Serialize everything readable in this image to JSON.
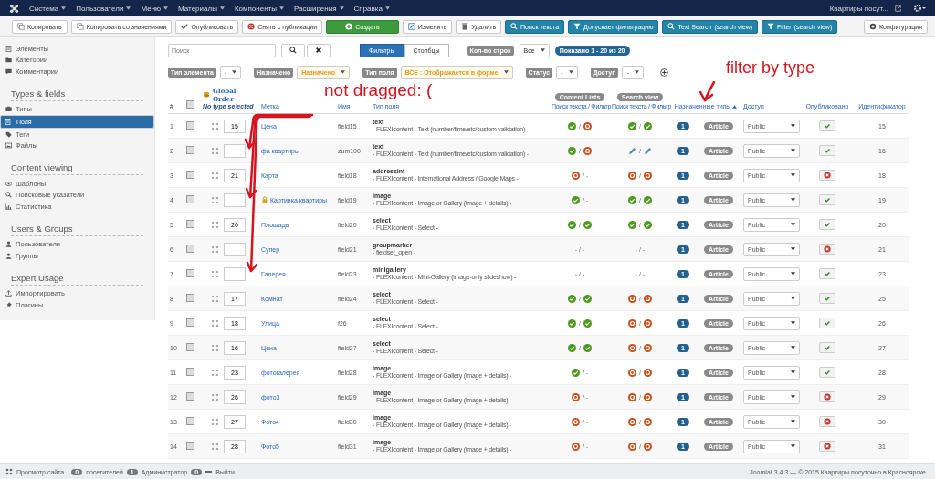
{
  "topnav": {
    "menus": [
      "Система",
      "Пользователи",
      "Меню",
      "Материалы",
      "Компоненты",
      "Расширения",
      "Справка"
    ],
    "site_link": "Квартиры посут..."
  },
  "toolbar": {
    "buttons": [
      {
        "label": "Копировать",
        "kind": "copy"
      },
      {
        "label": "Копировать со значениями",
        "kind": "copy"
      },
      {
        "label": "Опубликовать",
        "kind": "publish"
      },
      {
        "label": "Снять с публикации",
        "kind": "unpublish"
      },
      {
        "label": "Создать",
        "kind": "create"
      },
      {
        "label": "Изменить",
        "kind": "edit"
      },
      {
        "label": "Удалить",
        "kind": "delete"
      },
      {
        "label": "Поиск текста",
        "kind": "search"
      },
      {
        "label": "Допускает фильтрацию",
        "kind": "filter"
      },
      {
        "label": "Text Search",
        "sub": "(search view)",
        "kind": "search"
      },
      {
        "label": "Filter",
        "sub": "(search view)",
        "kind": "filter"
      }
    ],
    "config": "Конфигурация"
  },
  "sidebar": {
    "sections": [
      {
        "items": [
          {
            "label": "Элементы",
            "kind": "doc",
            "selected": false
          },
          {
            "label": "Категории",
            "kind": "folder",
            "selected": false
          },
          {
            "label": "Комментарии",
            "kind": "chat",
            "selected": false
          }
        ]
      },
      {
        "title": "Types & fields",
        "items": [
          {
            "label": "Типы",
            "kind": "box",
            "selected": false
          },
          {
            "label": "Поля",
            "kind": "doc",
            "selected": true
          },
          {
            "label": "Теги",
            "kind": "tag",
            "selected": false
          },
          {
            "label": "Файлы",
            "kind": "image",
            "selected": false
          }
        ]
      },
      {
        "title": "Content viewing",
        "items": [
          {
            "label": "Шаблоны",
            "kind": "eye",
            "selected": false
          },
          {
            "label": "Поисковые указатели",
            "kind": "search",
            "selected": false
          },
          {
            "label": "Статистика",
            "kind": "chart",
            "selected": false
          }
        ]
      },
      {
        "title": "Users & Groups",
        "items": [
          {
            "label": "Пользователи",
            "kind": "user",
            "selected": false
          },
          {
            "label": "Группы",
            "kind": "user",
            "selected": false
          }
        ]
      },
      {
        "title": "Expert Usage",
        "items": [
          {
            "label": "Импортировать",
            "kind": "upload",
            "selected": false
          },
          {
            "label": "Плагины",
            "kind": "plug",
            "selected": false
          }
        ]
      }
    ]
  },
  "search": {
    "placeholder": "Поиск"
  },
  "view_toggle": [
    {
      "label": "Фильтры",
      "selected": true
    },
    {
      "label": "Столбцы",
      "selected": false
    }
  ],
  "rows_per_page": {
    "label": "Кол-во строк",
    "value": "Все"
  },
  "shown_badge": "Показано 1 - 20 из 20",
  "filters": [
    {
      "label": "Тип элемента",
      "value": "-",
      "active": false
    },
    {
      "label": "Назначено",
      "value": "Назначено",
      "active": true
    },
    {
      "label": "Тип поля",
      "value": "ВСЕ : Отображается в форме",
      "active": true
    },
    {
      "label": "Статус",
      "value": "-",
      "active": false
    },
    {
      "label": "Доступ",
      "value": "-",
      "active": false
    }
  ],
  "table": {
    "columns": {
      "number": "#",
      "global_order": "Global Order",
      "global_order_note": "No type selected",
      "label": "Метка",
      "name": "Имя",
      "field_type": "Тип поля",
      "content_lists": "Content Lists",
      "content_lists_sub": "Поиск текста / Фильтр",
      "search_view": "Search view",
      "search_view_sub": "Поиск текста / Фильтр",
      "assigned_types": "Назначенные типы",
      "access": "Доступ",
      "published": "Опубликовано",
      "id": "Идентификатор"
    },
    "header_checked": false,
    "rows": [
      {
        "number": "1",
        "checked": false,
        "order": "15",
        "label": "Цена",
        "locked": false,
        "name": "field15",
        "type": "text",
        "description": "- FLEXIcontent - Text (number/time/etc/custom validation) -",
        "content_lists": [
          {
            "kind": "yes"
          },
          {
            "kind": "text",
            "text": "/"
          },
          {
            "kind": "no"
          }
        ],
        "search_view": [
          {
            "kind": "yes"
          },
          {
            "kind": "text",
            "text": "/"
          },
          {
            "kind": "yes"
          }
        ],
        "types_count": "1",
        "type_tag": "Article",
        "access": "Public",
        "published": true,
        "id": "15"
      },
      {
        "number": "2",
        "checked": false,
        "order": "",
        "label": "фа квартиры",
        "locked": false,
        "name": "zum100",
        "type": "text",
        "description": "- FLEXIcontent - Text (number/time/etc/custom validation) -",
        "content_lists": [
          {
            "kind": "yes"
          },
          {
            "kind": "text",
            "text": "/"
          },
          {
            "kind": "no"
          }
        ],
        "search_view": [
          {
            "kind": "edit"
          },
          {
            "kind": "text",
            "text": "/"
          },
          {
            "kind": "edit"
          }
        ],
        "types_count": "1",
        "type_tag": "Article",
        "access": "Public",
        "published": true,
        "id": "16"
      },
      {
        "number": "3",
        "checked": false,
        "order": "21",
        "label": "Карта",
        "locked": false,
        "name": "field18",
        "type": "addressint",
        "description": "- FLEXIcontent - International Address / Google Maps -",
        "content_lists": [
          {
            "kind": "no"
          },
          {
            "kind": "text",
            "text": "/ -"
          }
        ],
        "search_view": [
          {
            "kind": "no"
          },
          {
            "kind": "text",
            "text": "/"
          },
          {
            "kind": "no"
          }
        ],
        "types_count": "1",
        "type_tag": "Article",
        "access": "Public",
        "published": false,
        "id": "18"
      },
      {
        "number": "4",
        "checked": false,
        "order": "",
        "label": "Картинка квартиры",
        "locked": true,
        "name": "field19",
        "type": "image",
        "description": "- FLEXIcontent - Image or Gallery (image + details) -",
        "content_lists": [
          {
            "kind": "yes"
          },
          {
            "kind": "text",
            "text": "/ -"
          }
        ],
        "search_view": [
          {
            "kind": "yes"
          },
          {
            "kind": "text",
            "text": "/"
          },
          {
            "kind": "yes"
          }
        ],
        "types_count": "1",
        "type_tag": "Article",
        "access": "Public",
        "published": true,
        "id": "19"
      },
      {
        "number": "5",
        "checked": false,
        "order": "20",
        "label": "Площадь",
        "locked": false,
        "name": "field20",
        "type": "select",
        "description": "- FLEXIcontent - Select -",
        "content_lists": [
          {
            "kind": "yes"
          },
          {
            "kind": "text",
            "text": "/"
          },
          {
            "kind": "yes"
          }
        ],
        "search_view": [
          {
            "kind": "yes"
          },
          {
            "kind": "text",
            "text": "/"
          },
          {
            "kind": "yes"
          }
        ],
        "types_count": "1",
        "type_tag": "Article",
        "access": "Public",
        "published": true,
        "id": "20"
      },
      {
        "number": "6",
        "checked": false,
        "order": "",
        "label": "Супер",
        "locked": false,
        "name": "field21",
        "type": "groupmarker",
        "description": "- fieldset_open -",
        "content_lists": [
          {
            "kind": "text",
            "text": "- / -"
          }
        ],
        "search_view": [
          {
            "kind": "text",
            "text": "- / -"
          }
        ],
        "types_count": "1",
        "type_tag": "Article",
        "access": "Public",
        "published": false,
        "id": "21"
      },
      {
        "number": "7",
        "checked": false,
        "order": "",
        "label": "Галерея",
        "locked": false,
        "name": "field23",
        "type": "minigallery",
        "description": "- FLEXIcontent - Mini-Gallery (image-only slideshow) -",
        "content_lists": [
          {
            "kind": "text",
            "text": "- / -"
          }
        ],
        "search_view": [
          {
            "kind": "text",
            "text": "- / -"
          }
        ],
        "types_count": "1",
        "type_tag": "Article",
        "access": "Public",
        "published": true,
        "id": "23"
      },
      {
        "number": "8",
        "checked": false,
        "order": "17",
        "label": "Комнат",
        "locked": false,
        "name": "field24",
        "type": "select",
        "description": "- FLEXIcontent - Select -",
        "content_lists": [
          {
            "kind": "yes"
          },
          {
            "kind": "text",
            "text": "/"
          },
          {
            "kind": "yes"
          }
        ],
        "search_view": [
          {
            "kind": "no"
          },
          {
            "kind": "text",
            "text": "/"
          },
          {
            "kind": "no"
          }
        ],
        "types_count": "1",
        "type_tag": "Article",
        "access": "Public",
        "published": true,
        "id": "25"
      },
      {
        "number": "9",
        "checked": false,
        "order": "18",
        "label": "Улица",
        "locked": false,
        "name": "f26",
        "type": "select",
        "description": "- FLEXIcontent - Select -",
        "content_lists": [
          {
            "kind": "yes"
          },
          {
            "kind": "text",
            "text": "/"
          },
          {
            "kind": "yes"
          }
        ],
        "search_view": [
          {
            "kind": "no"
          },
          {
            "kind": "text",
            "text": "/"
          },
          {
            "kind": "no"
          }
        ],
        "types_count": "1",
        "type_tag": "Article",
        "access": "Public",
        "published": true,
        "id": "26"
      },
      {
        "number": "10",
        "checked": false,
        "order": "16",
        "label": "Цена",
        "locked": false,
        "name": "field27",
        "type": "select",
        "description": "- FLEXIcontent - Select -",
        "content_lists": [
          {
            "kind": "yes"
          },
          {
            "kind": "text",
            "text": "/"
          },
          {
            "kind": "yes"
          }
        ],
        "search_view": [
          {
            "kind": "no"
          },
          {
            "kind": "text",
            "text": "/"
          },
          {
            "kind": "no"
          }
        ],
        "types_count": "1",
        "type_tag": "Article",
        "access": "Public",
        "published": true,
        "id": "27"
      },
      {
        "number": "11",
        "checked": false,
        "order": "23",
        "label": "фотогалерея",
        "locked": false,
        "name": "field28",
        "type": "image",
        "description": "- FLEXIcontent - Image or Gallery (image + details) -",
        "content_lists": [
          {
            "kind": "yes"
          },
          {
            "kind": "text",
            "text": "/ -"
          }
        ],
        "search_view": [
          {
            "kind": "no"
          },
          {
            "kind": "text",
            "text": "/"
          },
          {
            "kind": "no"
          }
        ],
        "types_count": "1",
        "type_tag": "Article",
        "access": "Public",
        "published": true,
        "id": "28"
      },
      {
        "number": "12",
        "checked": false,
        "order": "26",
        "label": "фото3",
        "locked": false,
        "name": "field29",
        "type": "image",
        "description": "- FLEXIcontent - Image or Gallery (image + details) -",
        "content_lists": [
          {
            "kind": "no"
          },
          {
            "kind": "text",
            "text": "/ -"
          }
        ],
        "search_view": [
          {
            "kind": "no"
          },
          {
            "kind": "text",
            "text": "/"
          },
          {
            "kind": "no"
          }
        ],
        "types_count": "1",
        "type_tag": "Article",
        "access": "Public",
        "published": false,
        "id": "29"
      },
      {
        "number": "13",
        "checked": false,
        "order": "27",
        "label": "Фото4",
        "locked": false,
        "name": "field30",
        "type": "image",
        "description": "- FLEXIcontent - Image or Gallery (image + details) -",
        "content_lists": [
          {
            "kind": "no"
          },
          {
            "kind": "text",
            "text": "/ -"
          }
        ],
        "search_view": [
          {
            "kind": "no"
          },
          {
            "kind": "text",
            "text": "/"
          },
          {
            "kind": "no"
          }
        ],
        "types_count": "1",
        "type_tag": "Article",
        "access": "Public",
        "published": false,
        "id": "30"
      },
      {
        "number": "14",
        "checked": false,
        "order": "28",
        "label": "Фото5",
        "locked": false,
        "name": "field31",
        "type": "image",
        "description": "- FLEXIcontent - Image or Gallery (image + details) -",
        "content_lists": [
          {
            "kind": "no"
          },
          {
            "kind": "text",
            "text": "/ -"
          }
        ],
        "search_view": [
          {
            "kind": "no"
          },
          {
            "kind": "text",
            "text": "/"
          },
          {
            "kind": "no"
          }
        ],
        "types_count": "1",
        "type_tag": "Article",
        "access": "Public",
        "published": false,
        "id": "31"
      }
    ]
  },
  "annotations": {
    "not_dragged": "not dragged: (",
    "filter_by_type": "filter by type"
  },
  "status_bar": {
    "view_site": "Просмотр сайта",
    "visitors_count": "0",
    "visitors": "посетителей",
    "admins_count": "1",
    "admins": "Администратор",
    "logout_count": "0",
    "logout": "Выйти",
    "copyright": "Joomla! 3.4.3 — © 2015 Квартиры посуточно в Красноярске"
  }
}
